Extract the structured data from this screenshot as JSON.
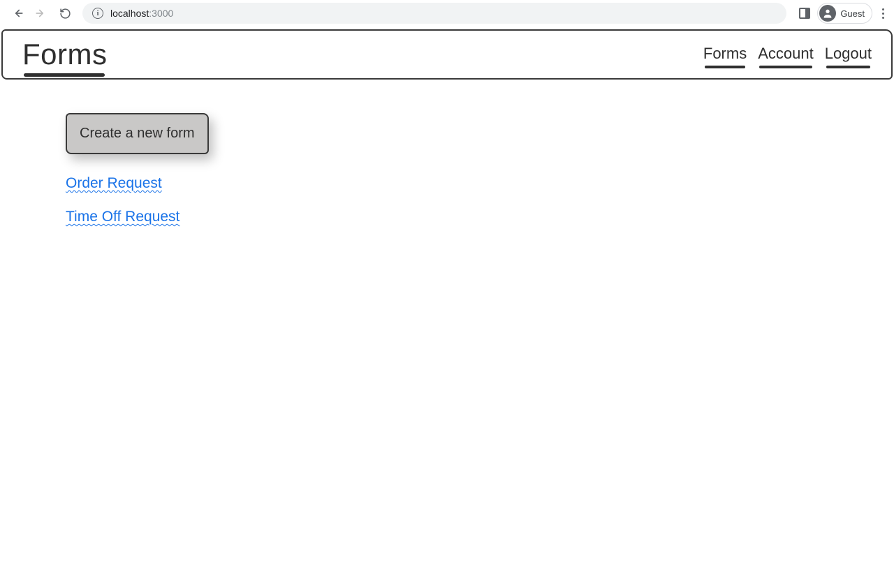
{
  "browser": {
    "url_host": "localhost",
    "url_port": ":3000",
    "profile_label": "Guest"
  },
  "header": {
    "title": "Forms",
    "nav": [
      "Forms",
      "Account",
      "Logout"
    ]
  },
  "content": {
    "create_button": "Create a new form",
    "forms": [
      "Order Request",
      "Time Off Request"
    ]
  }
}
